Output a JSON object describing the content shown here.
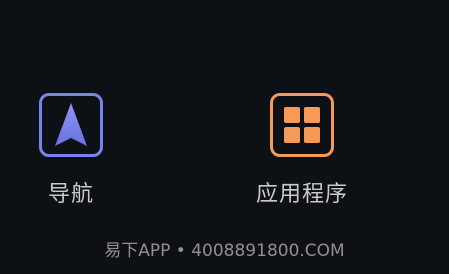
{
  "apps": [
    {
      "label": "导航",
      "icon": "navigation-arrow-icon",
      "accent": "#7b83ea"
    },
    {
      "label": "应用程序",
      "icon": "app-grid-icon",
      "accent": "#f49a5b"
    }
  ],
  "watermark": {
    "text": "易下APP • 4008891800.COM"
  },
  "colors": {
    "background": "#0d1014",
    "label": "#c9cacc"
  }
}
